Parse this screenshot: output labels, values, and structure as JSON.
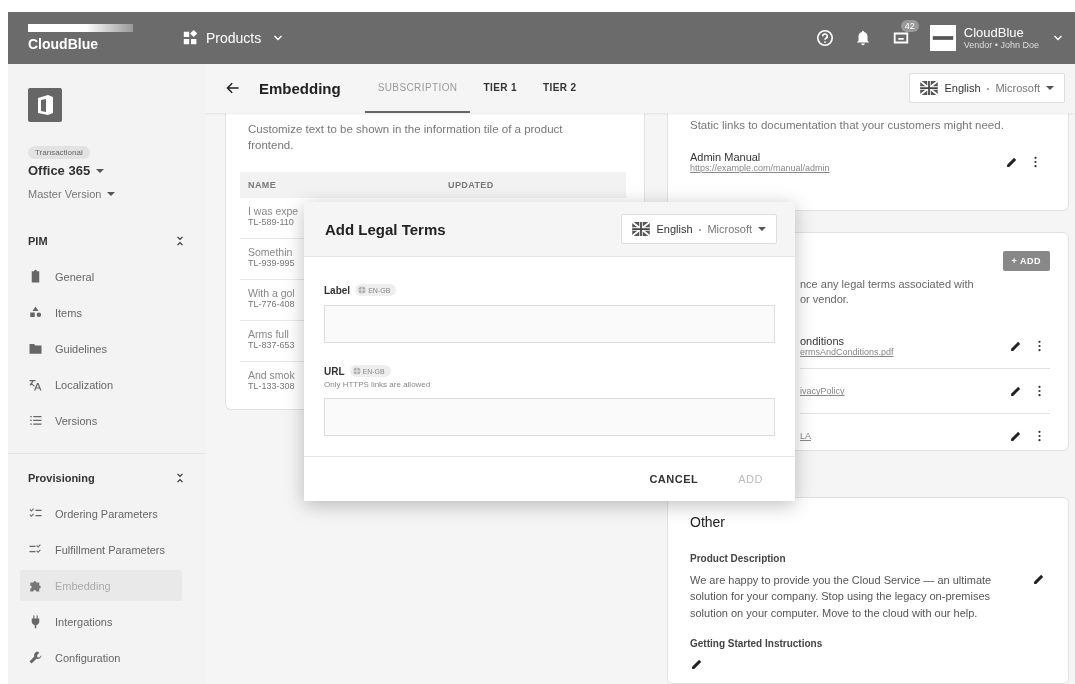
{
  "topbar": {
    "logo": "CloudBlue",
    "menu": "Products",
    "notifications_badge": "42",
    "account": {
      "name": "CloudBlue",
      "role": "Vendor",
      "separator": "•",
      "user": "John Doe"
    }
  },
  "sidebar": {
    "product_type": "Transactional",
    "product": "Office 365",
    "version": "Master Version",
    "sections": [
      {
        "title": "PIM",
        "items": [
          {
            "label": "General",
            "selected": false
          },
          {
            "label": "Items",
            "selected": false
          },
          {
            "label": "Guidelines",
            "selected": false
          },
          {
            "label": "Localization",
            "selected": false
          },
          {
            "label": "Versions",
            "selected": false
          }
        ]
      },
      {
        "title": "Provisioning",
        "items": [
          {
            "label": "Ordering Parameters",
            "selected": false
          },
          {
            "label": "Fulfillment Parameters",
            "selected": false
          },
          {
            "label": "Embedding",
            "selected": true
          },
          {
            "label": "Intergations",
            "selected": false
          },
          {
            "label": "Configuration",
            "selected": false
          }
        ]
      }
    ]
  },
  "header": {
    "title": "Embedding",
    "tabs": [
      {
        "label": "SUBSCRIPTION",
        "selected": true
      },
      {
        "label": "TIER 1",
        "selected": false
      },
      {
        "label": "TIER 2",
        "selected": false
      }
    ],
    "language": {
      "name": "English",
      "separator": "•",
      "vendor": "Microsoft"
    }
  },
  "info_card": {
    "description": "Customize text to be shown in the information tile of a product frontend.",
    "columns": [
      "NAME",
      "UPDATED"
    ],
    "rows": [
      {
        "name": "I was expe",
        "id": "TL-589-110"
      },
      {
        "name": "Somethin",
        "id": "TL-939-995"
      },
      {
        "name": "With a gol",
        "id": "TL-776-408"
      },
      {
        "name": "Arms full",
        "id": "TL-837-653"
      },
      {
        "name": "And smok",
        "id": "TL-133-308"
      }
    ]
  },
  "documents_card": {
    "description": "Static links to documentation that your customers might need.",
    "items": [
      {
        "title": "Admin Manual",
        "url": "https://example.com/manual/admin"
      }
    ]
  },
  "legal_card": {
    "add_button": "+ ADD",
    "description_lines": [
      "nce any legal terms associated with",
      "or vendor."
    ],
    "items": [
      {
        "title": "onditions",
        "url": "ermsAndConditions.pdf"
      },
      {
        "url": "ivacyPolicy"
      },
      {
        "url": "LA"
      }
    ]
  },
  "other_card": {
    "title": "Other",
    "sections": [
      {
        "title": "Product Description",
        "text": "We are happy to provide you the Cloud Service — an ultimate solution for your company. Stop using the legacy on-premises solution on your computer. Move to the cloud with our help."
      },
      {
        "title": "Getting Started Instructions"
      }
    ]
  },
  "dialog": {
    "title": "Add Legal Terms",
    "language": {
      "name": "English",
      "separator": "•",
      "vendor": "Microsoft"
    },
    "fields": [
      {
        "label": "Label",
        "locale": "EN-GB"
      },
      {
        "label": "URL",
        "locale": "EN-GB",
        "hint": "Only HTTPS links are allowed"
      }
    ],
    "buttons": [
      {
        "label": "CANCEL",
        "disabled": false
      },
      {
        "label": "ADD",
        "disabled": true
      }
    ]
  }
}
